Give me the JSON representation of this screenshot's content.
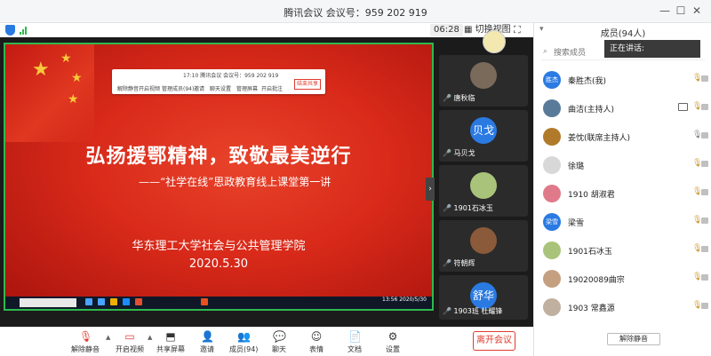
{
  "window": {
    "title": "腾讯会议 会议号：959 202 919",
    "controls": {
      "minimize": "—",
      "maximize": "☐",
      "close": "✕"
    }
  },
  "stage": {
    "timer": "06:28",
    "switch_view": "切换视图",
    "slide": {
      "title": "弘扬援鄂精神，致敬最美逆行",
      "subtitle": "——“社学在线”思政教育线上课堂第一讲",
      "school": "华东理工大学社会与公共管理学院",
      "date": "2020.5.30"
    },
    "inner_toolbar": {
      "meeting_info": "17:10  腾讯会议 会议号：959 202 919",
      "items": [
        "解除静音",
        "开启视频",
        "管理成员(94)",
        "邀请",
        "聊天设置",
        "管理屏幕",
        "开启批注"
      ],
      "leave": "结束共享"
    },
    "taskbar": {
      "clock": "13:56\n2020/5/30"
    }
  },
  "thumbnails": [
    {
      "name": "唐秋临",
      "avatar_text": "",
      "color": "#7a6a5a"
    },
    {
      "name": "马贝戈",
      "avatar_text": "贝戈",
      "color": "#2a7ae2"
    },
    {
      "name": "1901石冰玉",
      "avatar_text": "",
      "color": "#a9c47a"
    },
    {
      "name": "符朝辉",
      "avatar_text": "",
      "color": "#8a5a3a"
    },
    {
      "name": "1903班 杜耀锋",
      "avatar_text": "舒华",
      "color": "#2a7ae2"
    }
  ],
  "toolbar": {
    "items": [
      {
        "label": "解除静音",
        "icon": "mic-off-icon"
      },
      {
        "label": "开启视频",
        "icon": "camera-off-icon"
      },
      {
        "label": "共享屏幕",
        "icon": "share-screen-icon"
      },
      {
        "label": "邀请",
        "icon": "invite-icon"
      },
      {
        "label": "成员(94)",
        "icon": "members-icon"
      },
      {
        "label": "聊天",
        "icon": "chat-icon"
      },
      {
        "label": "表情",
        "icon": "emoji-icon"
      },
      {
        "label": "文档",
        "icon": "document-icon"
      },
      {
        "label": "设置",
        "icon": "settings-icon"
      }
    ],
    "leave": "离开会议"
  },
  "panel": {
    "title": "成员(94人)",
    "speaking": "正在讲话:",
    "search_placeholder": "搜索成员",
    "members": [
      {
        "name": "秦胜杰(我)",
        "avatar_text": "胜杰",
        "color": "#2a7ae2",
        "sharing": false
      },
      {
        "name": "曲洁(主持人)",
        "avatar_text": "",
        "color": "#5a7a9a",
        "sharing": true
      },
      {
        "name": "姜忱(联席主持人)",
        "avatar_text": "",
        "color": "#b07a2a",
        "sharing": false
      },
      {
        "name": "徐璐",
        "avatar_text": "",
        "color": "#d8d8d8",
        "sharing": false
      },
      {
        "name": "1910 胡淑君",
        "avatar_text": "",
        "color": "#e07a8a",
        "sharing": false
      },
      {
        "name": "梁雪",
        "avatar_text": "梁雪",
        "color": "#2a7ae2",
        "sharing": false
      },
      {
        "name": "1901石冰玉",
        "avatar_text": "",
        "color": "#a9c47a",
        "sharing": false
      },
      {
        "name": "19020089曲宗",
        "avatar_text": "",
        "color": "#c4a080",
        "sharing": false
      },
      {
        "name": "1903 常鑫源",
        "avatar_text": "",
        "color": "#c0b0a0",
        "sharing": false
      }
    ],
    "mute_all": "解除静音"
  }
}
